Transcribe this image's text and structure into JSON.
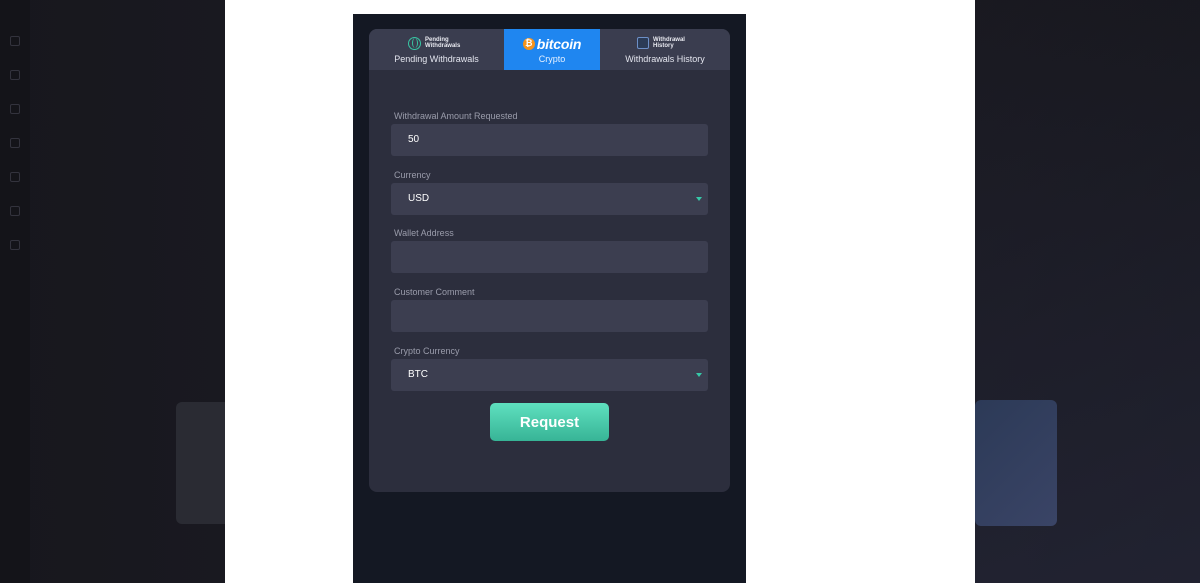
{
  "tabs": [
    {
      "mini": "Pending Withdrawals",
      "label": "Pending Withdrawals",
      "icon": "globe-icon"
    },
    {
      "brand": "bitcoin",
      "label": "Crypto",
      "icon": "bitcoin-icon",
      "coin_symbol": "₿",
      "active": true
    },
    {
      "mini": "Withdrawal History",
      "label": "Withdrawals History",
      "icon": "history-icon"
    }
  ],
  "form": {
    "amount": {
      "label": "Withdrawal Amount Requested",
      "value": "50"
    },
    "currency": {
      "label": "Currency",
      "value": "USD"
    },
    "wallet": {
      "label": "Wallet Address",
      "value": ""
    },
    "comment": {
      "label": "Customer Comment",
      "value": ""
    },
    "crypto": {
      "label": "Crypto Currency",
      "value": "BTC"
    }
  },
  "request_label": "Request",
  "colors": {
    "active_tab": "#1f86f0",
    "accent": "#36c9a8",
    "panel": "#2c2e3d",
    "field": "#3c3e50"
  }
}
